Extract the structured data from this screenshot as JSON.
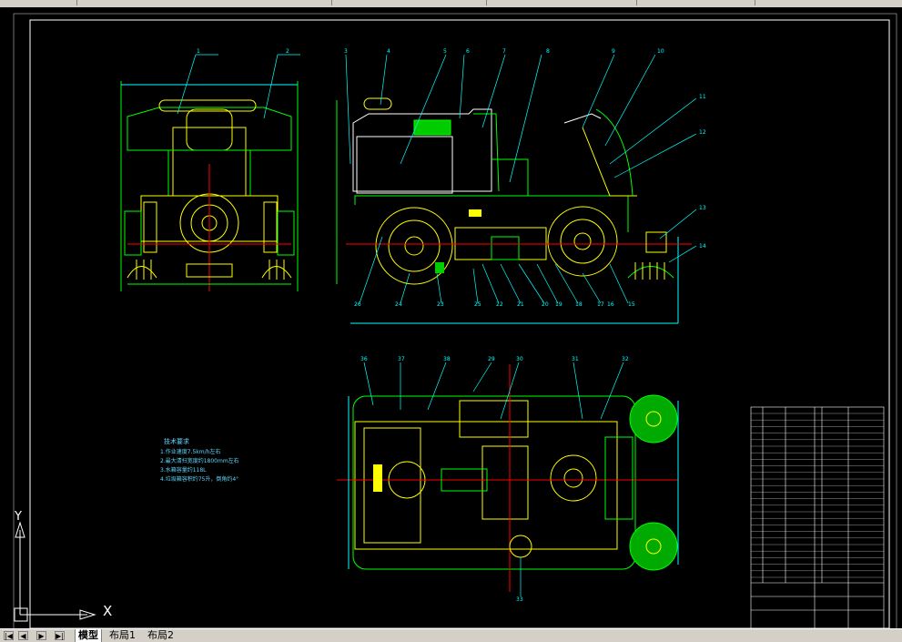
{
  "toolbar": {
    "segments": [
      "",
      "",
      "",
      "",
      "",
      ""
    ]
  },
  "notes": {
    "title": "技术要求",
    "lines": [
      "1.作业速度7.5km/h左右",
      "2.最大清扫宽度约1800mm左右",
      "3.水箱容量约118L",
      "4.垃圾箱容积约75升，倒角约4°"
    ]
  },
  "axes": {
    "x": "X",
    "y": "Y"
  },
  "tabs": {
    "model": "模型",
    "layout1": "布局1",
    "layout2": "布局2"
  },
  "balloons": {
    "top_front": [
      "1",
      "2"
    ],
    "top_side": [
      "3",
      "4",
      "5",
      "6",
      "7",
      "8",
      "9",
      "10"
    ],
    "right_side": [
      "11",
      "12",
      "13",
      "14"
    ],
    "bottom_side": [
      "26",
      "24",
      "23",
      "25",
      "22",
      "21",
      "20",
      "19",
      "18",
      "17",
      "16",
      "15"
    ],
    "plan_top": [
      "36",
      "37",
      "38",
      "29",
      "30",
      "31",
      "32"
    ],
    "plan_bottom": [
      "33"
    ]
  },
  "colors": {
    "background": "#000000",
    "frame": "#ffffff",
    "geometry": "#ffff00",
    "geometry2": "#00ff00",
    "leader": "#00ffff",
    "center": "#ff0000",
    "accent": "#ff00ff"
  }
}
